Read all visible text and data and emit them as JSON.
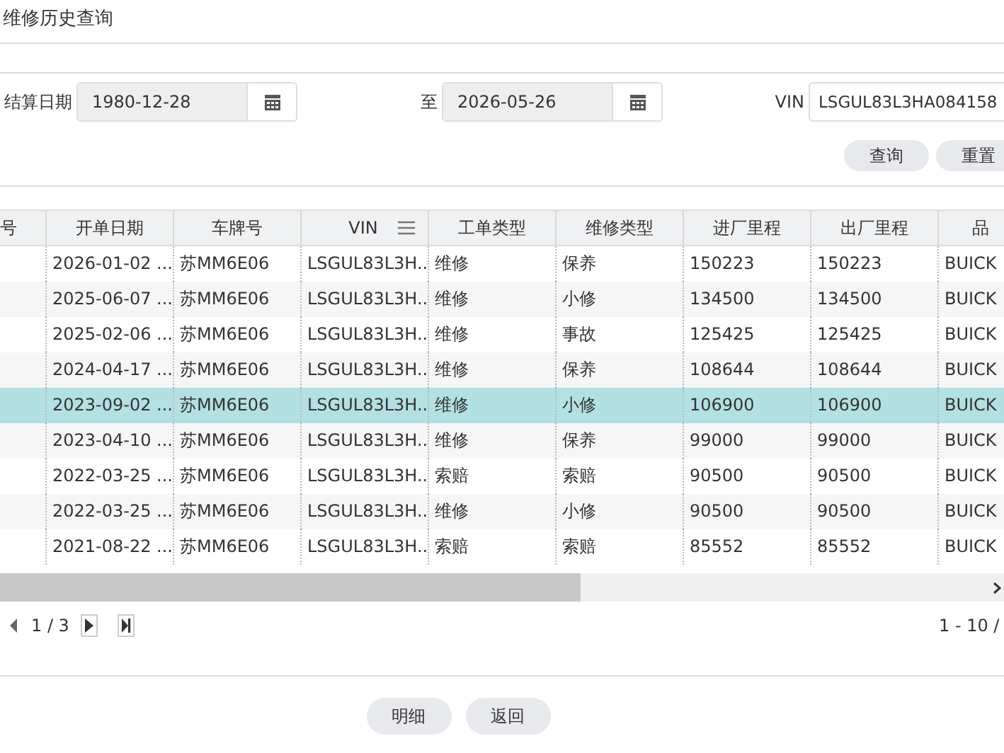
{
  "window": {
    "title": "维修历史查询"
  },
  "filters": {
    "date_label": "结算日期",
    "date_from": "1980-12-28",
    "to_label": "至",
    "date_to": "2026-05-26",
    "vin_label": "VIN",
    "vin": "LSGUL83L3HA084158"
  },
  "actions": [
    "查询",
    "重置"
  ],
  "table": {
    "columns": [
      "号",
      "开单日期",
      "车牌号",
      "VIN",
      "工单类型",
      "维修类型",
      "进厂里程",
      "出厂里程",
      "品"
    ],
    "rows": [
      {
        "selected": false,
        "cells": [
          "",
          "2026-01-02 ...",
          "苏MM6E06",
          "LSGUL83L3H...",
          "维修",
          "保养",
          "150223",
          "150223",
          "BUICK"
        ]
      },
      {
        "selected": false,
        "cells": [
          "",
          "2025-06-07 ...",
          "苏MM6E06",
          "LSGUL83L3H...",
          "维修",
          "小修",
          "134500",
          "134500",
          "BUICK"
        ]
      },
      {
        "selected": false,
        "cells": [
          "",
          "2025-02-06 ...",
          "苏MM6E06",
          "LSGUL83L3H...",
          "维修",
          "事故",
          "125425",
          "125425",
          "BUICK"
        ]
      },
      {
        "selected": false,
        "cells": [
          "",
          "2024-04-17 ...",
          "苏MM6E06",
          "LSGUL83L3H...",
          "维修",
          "保养",
          "108644",
          "108644",
          "BUICK"
        ]
      },
      {
        "selected": true,
        "cells": [
          "",
          "2023-09-02 ...",
          "苏MM6E06",
          "LSGUL83L3H...",
          "维修",
          "小修",
          "106900",
          "106900",
          "BUICK"
        ]
      },
      {
        "selected": false,
        "cells": [
          "",
          "2023-04-10 ...",
          "苏MM6E06",
          "LSGUL83L3H...",
          "维修",
          "保养",
          "99000",
          "99000",
          "BUICK"
        ]
      },
      {
        "selected": false,
        "cells": [
          "",
          "2022-03-25 ...",
          "苏MM6E06",
          "LSGUL83L3H...",
          "索赔",
          "索赔",
          "90500",
          "90500",
          "BUICK"
        ]
      },
      {
        "selected": false,
        "cells": [
          "",
          "2022-03-25 ...",
          "苏MM6E06",
          "LSGUL83L3H...",
          "维修",
          "小修",
          "90500",
          "90500",
          "BUICK"
        ]
      },
      {
        "selected": false,
        "cells": [
          "",
          "2021-08-22 ...",
          "苏MM6E06",
          "LSGUL83L3H...",
          "索赔",
          "索赔",
          "85552",
          "85552",
          "BUICK"
        ]
      }
    ]
  },
  "pager": {
    "page": "1 / 3",
    "range": "1 - 10 /"
  },
  "footer_buttons": [
    "明细",
    "返回"
  ]
}
